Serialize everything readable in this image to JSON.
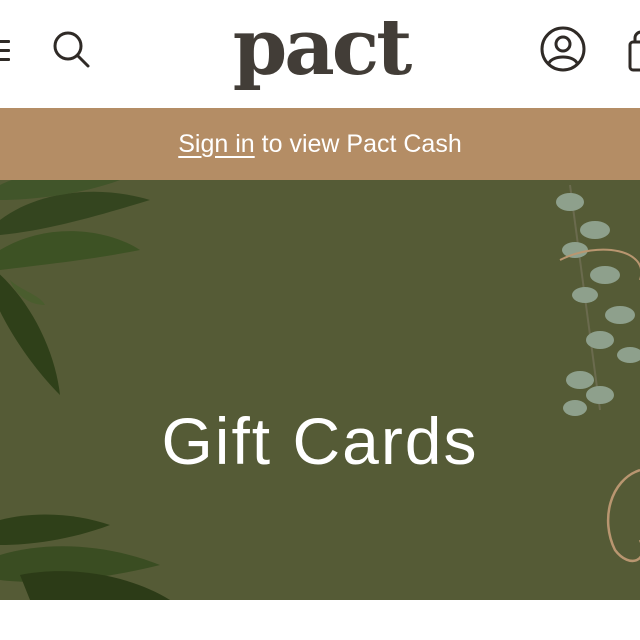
{
  "header": {
    "logo_text": "pact",
    "icons": {
      "menu": "hamburger-menu-icon",
      "search": "search-icon",
      "account": "user-account-icon",
      "cart": "shopping-bag-icon"
    }
  },
  "promo": {
    "link_label": "Sign in",
    "rest_text": " to view Pact Cash"
  },
  "hero": {
    "title": "Gift Cards"
  },
  "colors": {
    "brand_text": "#423d37",
    "promo_bar": "#b48d65",
    "hero_background": "#545a35"
  }
}
